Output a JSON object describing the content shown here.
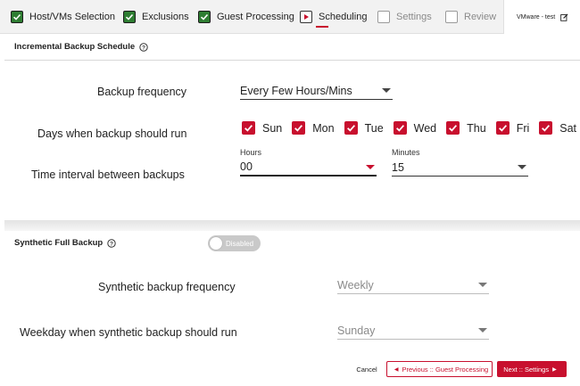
{
  "wizard": {
    "steps": [
      {
        "label": "Host/VMs Selection",
        "state": "done"
      },
      {
        "label": "Exclusions",
        "state": "done"
      },
      {
        "label": "Guest Processing",
        "state": "done"
      },
      {
        "label": "Scheduling",
        "state": "active"
      },
      {
        "label": "Settings",
        "state": "todo"
      },
      {
        "label": "Review",
        "state": "todo"
      }
    ],
    "vm_label": "VMware - test",
    "edit_icon": "edit-icon"
  },
  "incremental": {
    "title": "Incremental Backup Schedule",
    "help_icon": "help-circle-icon",
    "frequency_label": "Backup frequency",
    "frequency_value": "Every Few Hours/Mins",
    "days_label": "Days when backup should run",
    "days": [
      {
        "label": "Sun",
        "checked": true
      },
      {
        "label": "Mon",
        "checked": true
      },
      {
        "label": "Tue",
        "checked": true
      },
      {
        "label": "Wed",
        "checked": true
      },
      {
        "label": "Thu",
        "checked": true
      },
      {
        "label": "Fri",
        "checked": true
      },
      {
        "label": "Sat",
        "checked": true
      }
    ],
    "interval_label": "Time interval between backups",
    "hours_label": "Hours",
    "hours_value": "00",
    "minutes_label": "Minutes",
    "minutes_value": "15"
  },
  "synthetic": {
    "title": "Synthetic Full Backup",
    "help_icon": "help-circle-icon",
    "toggle_label": "Disabled",
    "toggle_on": false,
    "frequency_label": "Synthetic backup frequency",
    "frequency_value": "Weekly",
    "weekday_label": "Weekday when synthetic backup should run",
    "weekday_value": "Sunday"
  },
  "footer": {
    "cancel": "Cancel",
    "previous": "Previous :: Guest Processing",
    "next": "Next :: Settings"
  },
  "colors": {
    "accent": "#c8102e",
    "done_green": "#2e7d32",
    "toggle_off": "#c9c9c9"
  }
}
